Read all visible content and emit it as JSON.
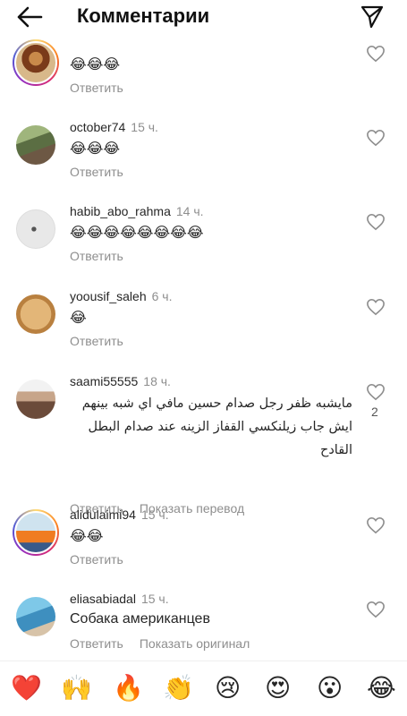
{
  "header": {
    "title": "Комментарии"
  },
  "actions": {
    "reply": "Ответить",
    "show_translation": "Показать перевод",
    "show_original": "Показать оригинал"
  },
  "comments": [
    {
      "username": "",
      "time": "",
      "text": "😂😂😂",
      "likes": ""
    },
    {
      "username": "october74",
      "time": "15 ч.",
      "text": "😂😂😂",
      "likes": ""
    },
    {
      "username": "habib_abo_rahma",
      "time": "14 ч.",
      "text": "😂😂😂😂😂😂😂😂",
      "likes": ""
    },
    {
      "username": "yoousif_saleh",
      "time": "6 ч.",
      "text": "😂",
      "likes": ""
    },
    {
      "username": "saami55555",
      "time": "18 ч.",
      "text": "مايشبه ظفر رجل صدام حسين مافي اي شبه بينهم ايش جاب زيلنكسي القفاز الزينه عند صدام البطل القادح",
      "likes": "2"
    },
    {
      "username": "alidulaimi94",
      "time": "15 ч.",
      "text": "😂😂",
      "likes": ""
    },
    {
      "username": "eliasabiadal",
      "time": "15 ч.",
      "text": "Собака американцев",
      "likes": ""
    }
  ],
  "emoji_bar": [
    "❤️",
    "🙌",
    "🔥",
    "👏",
    "😢",
    "😍",
    "😮",
    "😂"
  ],
  "colors": {
    "secondary_text": "#8e8e8e",
    "primary_text": "#262626"
  }
}
